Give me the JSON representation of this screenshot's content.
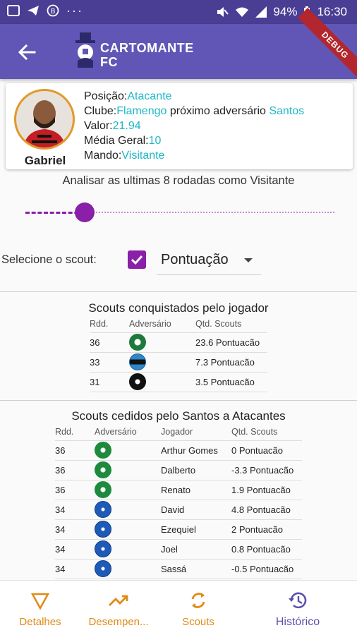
{
  "status_bar": {
    "battery": "94%",
    "time": "16:30",
    "dots": "···",
    "debug_label": "DEBUG"
  },
  "app_bar": {
    "logo_line1": "CARTOMANTE",
    "logo_line2": "FC"
  },
  "player": {
    "name": "Gabriel",
    "position_label": "Posição:",
    "position_value": "Atacante",
    "club_label": "Clube:",
    "club_value": "Flamengo",
    "next_label": " próximo adversário ",
    "next_value": "Santos",
    "value_label": "Valor:",
    "value_value": "21.94",
    "avg_label": "Média Geral:",
    "avg_value": "10",
    "home_label": "Mando:",
    "home_value": "Visitante"
  },
  "analysis": {
    "text": "Analisar as ultimas 8 rodadas como Visitante",
    "slider_value": 8
  },
  "scout": {
    "label": "Selecione o scout:",
    "selected": "Pontuação",
    "checked": true
  },
  "conquered": {
    "title": "Scouts conquistados pelo jogador",
    "headers": {
      "round": "Rdd.",
      "opponent": "Adversário",
      "qty": "Qtd. Scouts"
    },
    "rows": [
      {
        "round": "36",
        "crest": "palmeiras",
        "qty": "23.6 Pontuacão"
      },
      {
        "round": "33",
        "crest": "gremio",
        "qty": "7.3 Pontuacão"
      },
      {
        "round": "31",
        "crest": "botafogo",
        "qty": "3.5 Pontuacão"
      }
    ]
  },
  "conceded": {
    "title": "Scouts cedidos pelo Santos a Atacantes",
    "headers": {
      "round": "Rdd.",
      "opponent": "Adversário",
      "player": "Jogador",
      "qty": "Qtd. Scouts"
    },
    "rows": [
      {
        "round": "36",
        "crest": "chape",
        "player": "Arthur Gomes",
        "qty": "0 Pontuacão"
      },
      {
        "round": "36",
        "crest": "chape",
        "player": "Dalberto",
        "qty": "-3.3 Pontuacão"
      },
      {
        "round": "36",
        "crest": "chape",
        "player": "Renato",
        "qty": "1.9 Pontuacão"
      },
      {
        "round": "34",
        "crest": "cruzeiro",
        "player": "David",
        "qty": "4.8 Pontuacão"
      },
      {
        "round": "34",
        "crest": "cruzeiro",
        "player": "Ezequiel",
        "qty": "2 Pontuacão"
      },
      {
        "round": "34",
        "crest": "cruzeiro",
        "player": "Joel",
        "qty": "0.8 Pontuacão"
      },
      {
        "round": "34",
        "crest": "cruzeiro",
        "player": "Sassá",
        "qty": "-0.5 Pontuacão"
      }
    ]
  },
  "bottom_nav": [
    {
      "label": "Detalhes",
      "icon": "triangle-down-icon"
    },
    {
      "label": "Desempen...",
      "icon": "trending-up-icon"
    },
    {
      "label": "Scouts",
      "icon": "sync-icon"
    },
    {
      "label": "Histórico",
      "icon": "history-icon",
      "active": true
    }
  ],
  "colors": {
    "app_bar": "#6156b5",
    "status_bar": "#4a3e94",
    "accent": "#8a1fa8",
    "highlight": "#1fb7c5",
    "nav": "#e08a16",
    "nav_active": "#5b4fae"
  }
}
